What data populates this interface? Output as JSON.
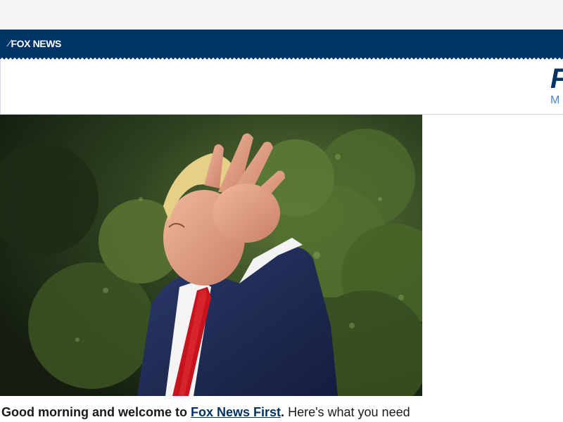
{
  "brand": {
    "logo_mark": "⁄",
    "logo_text": "FOX NEWS",
    "bar_color": "#003366"
  },
  "header": {
    "big_letter": "F",
    "sub_letter": "M"
  },
  "photo": {
    "subject": "man-in-navy-suit-waving"
  },
  "intro": {
    "lead": "Good morning and welcome to ",
    "link": "Fox News First",
    "period": ".",
    "rest": " Here's what you need"
  }
}
